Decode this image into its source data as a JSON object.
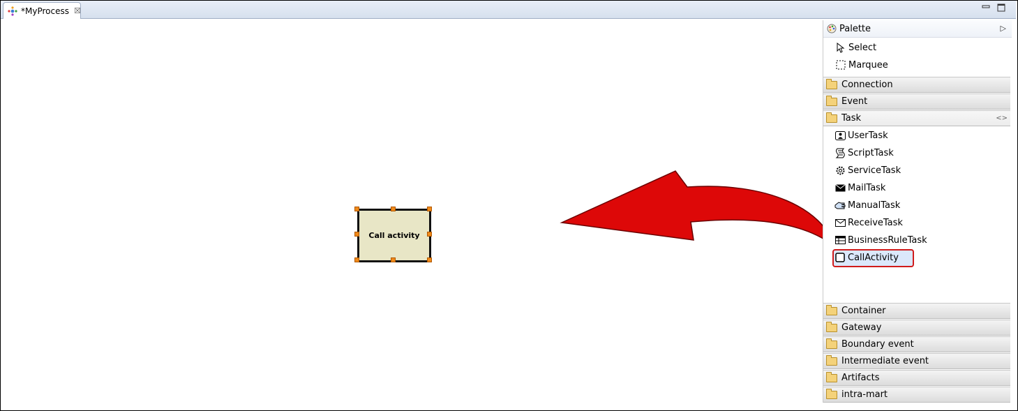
{
  "tab": {
    "title": "*MyProcess",
    "close_label": "☒"
  },
  "window_controls": {
    "minimize": "▭",
    "maximize": "◻"
  },
  "canvas": {
    "node_label": "Call activity",
    "arrow_color": "#dd0808"
  },
  "palette": {
    "title": "Palette",
    "tools": [
      {
        "label": "Select",
        "icon": "cursor-icon"
      },
      {
        "label": "Marquee",
        "icon": "marquee-icon"
      }
    ],
    "drawers_top": [
      "Connection",
      "Event",
      "Task"
    ],
    "task_items": [
      {
        "label": "UserTask",
        "icon": "user-task-icon"
      },
      {
        "label": "ScriptTask",
        "icon": "script-task-icon"
      },
      {
        "label": "ServiceTask",
        "icon": "service-task-icon"
      },
      {
        "label": "MailTask",
        "icon": "mail-task-icon"
      },
      {
        "label": "ManualTask",
        "icon": "manual-task-icon"
      },
      {
        "label": "ReceiveTask",
        "icon": "receive-task-icon"
      },
      {
        "label": "BusinessRuleTask",
        "icon": "business-rule-task-icon"
      },
      {
        "label": "CallActivity",
        "icon": "call-activity-icon",
        "selected": true
      }
    ],
    "drawers_bottom": [
      "Container",
      "Gateway",
      "Boundary event",
      "Intermediate event",
      "Artifacts",
      "intra-mart"
    ],
    "highlight_color": "#d01b1b"
  }
}
